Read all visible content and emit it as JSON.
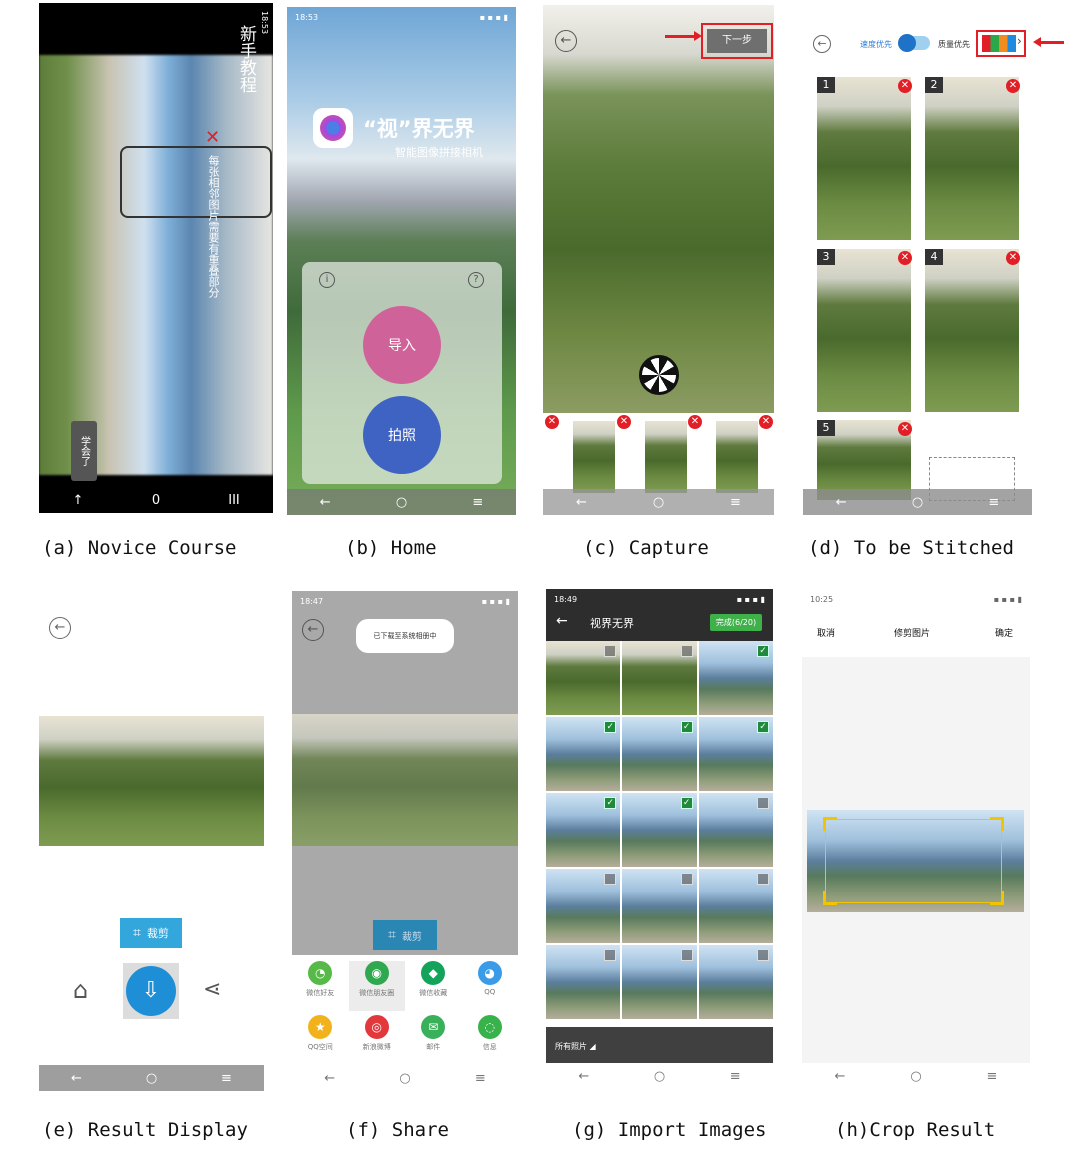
{
  "captions": {
    "a": "(a) Novice Course",
    "b": "(b) Home",
    "c": "(c) Capture",
    "d": "(d) To be Stitched",
    "e": "(e) Result Display",
    "f": "(f) Share",
    "g": "(g) Import Images",
    "h": "(h)Crop Result"
  },
  "panel_a": {
    "status_time": "18:53",
    "title": "新手教程",
    "hint": "每张相邻图片需要有重叠部分",
    "learned_button": "学会了",
    "nav": [
      "↑",
      "0",
      "III"
    ]
  },
  "panel_b": {
    "status_time": "18:53",
    "app_title": "“视”界无界",
    "app_subtitle": "智能图像拼接相机",
    "import_button": "导入",
    "photo_button": "拍照",
    "info_icon": "i",
    "help_icon": "?"
  },
  "panel_c": {
    "next_button": "下一步"
  },
  "panel_d": {
    "speed_label": "速度优先",
    "quality_label": "质量优先",
    "thumb_numbers": [
      "1",
      "2",
      "3",
      "4",
      "5"
    ]
  },
  "panel_e": {
    "crop_button": "裁剪"
  },
  "panel_f": {
    "status_time": "18:47",
    "toast": "已下载至系统相册中",
    "crop_button": "裁剪",
    "share_items": [
      {
        "label": "微信好友",
        "color": "#57b947",
        "glyph": "◔"
      },
      {
        "label": "微信朋友圈",
        "color": "#2fa84f",
        "glyph": "◉"
      },
      {
        "label": "微信收藏",
        "color": "#14a35a",
        "glyph": "◆"
      },
      {
        "label": "QQ",
        "color": "#3a9be8",
        "glyph": "◕"
      },
      {
        "label": "QQ空间",
        "color": "#f2b21b",
        "glyph": "★"
      },
      {
        "label": "新浪微博",
        "color": "#e2383c",
        "glyph": "◎"
      },
      {
        "label": "邮件",
        "color": "#3bb05a",
        "glyph": "✉"
      },
      {
        "label": "信息",
        "color": "#38b24a",
        "glyph": "◌"
      }
    ]
  },
  "panel_g": {
    "status_time": "18:49",
    "title": "视界无界",
    "done_button": "完成(6/20)",
    "album_label": "所有照片",
    "checked": [
      false,
      false,
      true,
      true,
      true,
      true,
      true,
      true,
      false,
      false,
      false,
      false,
      false,
      false,
      false
    ]
  },
  "panel_h": {
    "status_time": "10:25",
    "cancel": "取消",
    "title": "修剪图片",
    "confirm": "确定"
  },
  "colors": {
    "highlight_red": "#e21f26",
    "import_pink": "#d0629a",
    "photo_blue": "#3f63c2",
    "crop_blue": "#33a6dc",
    "download_blue": "#1e8fd6",
    "import_green": "#3fb04a",
    "crop_yellow": "#f2c400"
  }
}
